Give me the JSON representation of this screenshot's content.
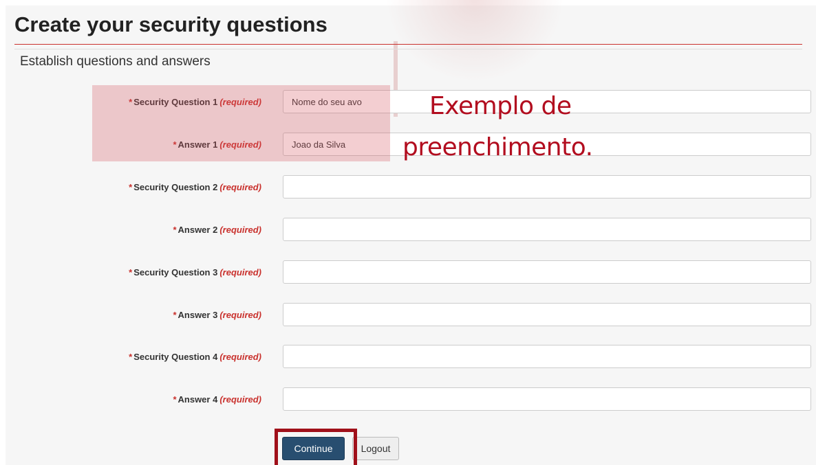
{
  "page": {
    "title": "Create your security questions",
    "subtitle": "Establish questions and answers"
  },
  "form": {
    "required_marker": "*",
    "required_text": "(required)",
    "rows": [
      {
        "label": "Security Question 1",
        "value": "Nome do seu avo"
      },
      {
        "label": "Answer 1",
        "value": "Joao da Silva"
      },
      {
        "label": "Security Question 2",
        "value": ""
      },
      {
        "label": "Answer 2",
        "value": ""
      },
      {
        "label": "Security Question 3",
        "value": ""
      },
      {
        "label": "Answer 3",
        "value": ""
      },
      {
        "label": "Security Question 4",
        "value": ""
      },
      {
        "label": "Answer 4",
        "value": ""
      }
    ]
  },
  "annotation": {
    "line1": "Exemplo de",
    "line2": "preenchimento."
  },
  "buttons": {
    "continue_label": "Continue",
    "logout_label": "Logout"
  },
  "colors": {
    "accent_red": "#c9302c",
    "annotation_red": "#b20d1f",
    "primary_button": "#284e70"
  }
}
